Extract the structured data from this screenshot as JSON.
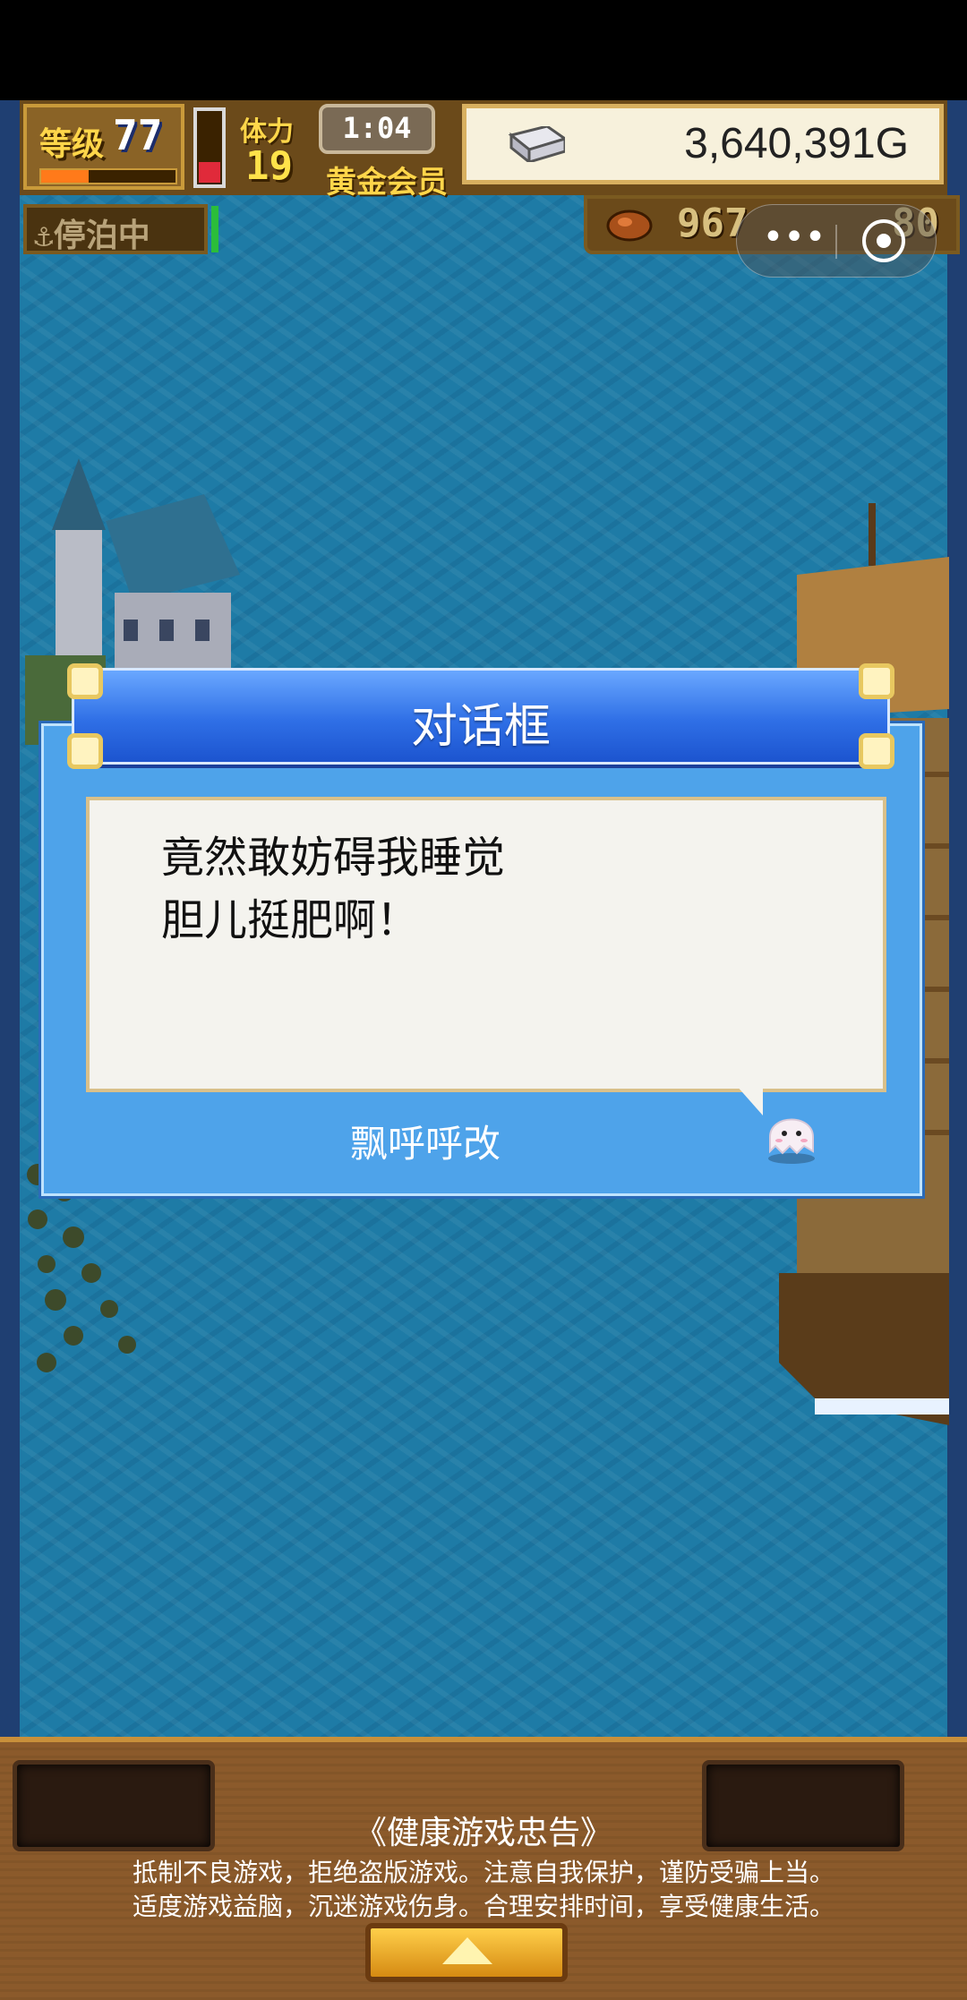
{
  "hud": {
    "level_label": "等级",
    "level_value": "77",
    "stamina_label": "体力",
    "stamina_value": "19",
    "timer": "1:04",
    "membership": "黄金会员",
    "gold_amount": "3,640,391G",
    "anchor_status": "停泊中",
    "food_value": "967",
    "resource2_value": "80"
  },
  "capsule": {
    "more_label": "•••"
  },
  "dialog": {
    "title": "对话框",
    "message": "竟然敢妨碍我睡觉\n胆儿挺肥啊！",
    "speaker": "飘呼呼改"
  },
  "footer": {
    "title": "《健康游戏忠告》",
    "line1": "抵制不良游戏，拒绝盗版游戏。注意自我保护，谨防受骗上当。",
    "line2": "适度游戏益脑，沉迷游戏伤身。合理安排时间，享受健康生活。"
  },
  "icons": [
    "anchor-icon",
    "silver-ingot-icon",
    "food-icon",
    "more-icon",
    "close-target-icon",
    "ghost-icon",
    "up-arrow-icon"
  ],
  "colors": {
    "dialog_blue": "#4ea3ea",
    "title_blue": "#2f6fe6",
    "gold_border": "#d8b060",
    "sea": "#1e7ba6"
  }
}
